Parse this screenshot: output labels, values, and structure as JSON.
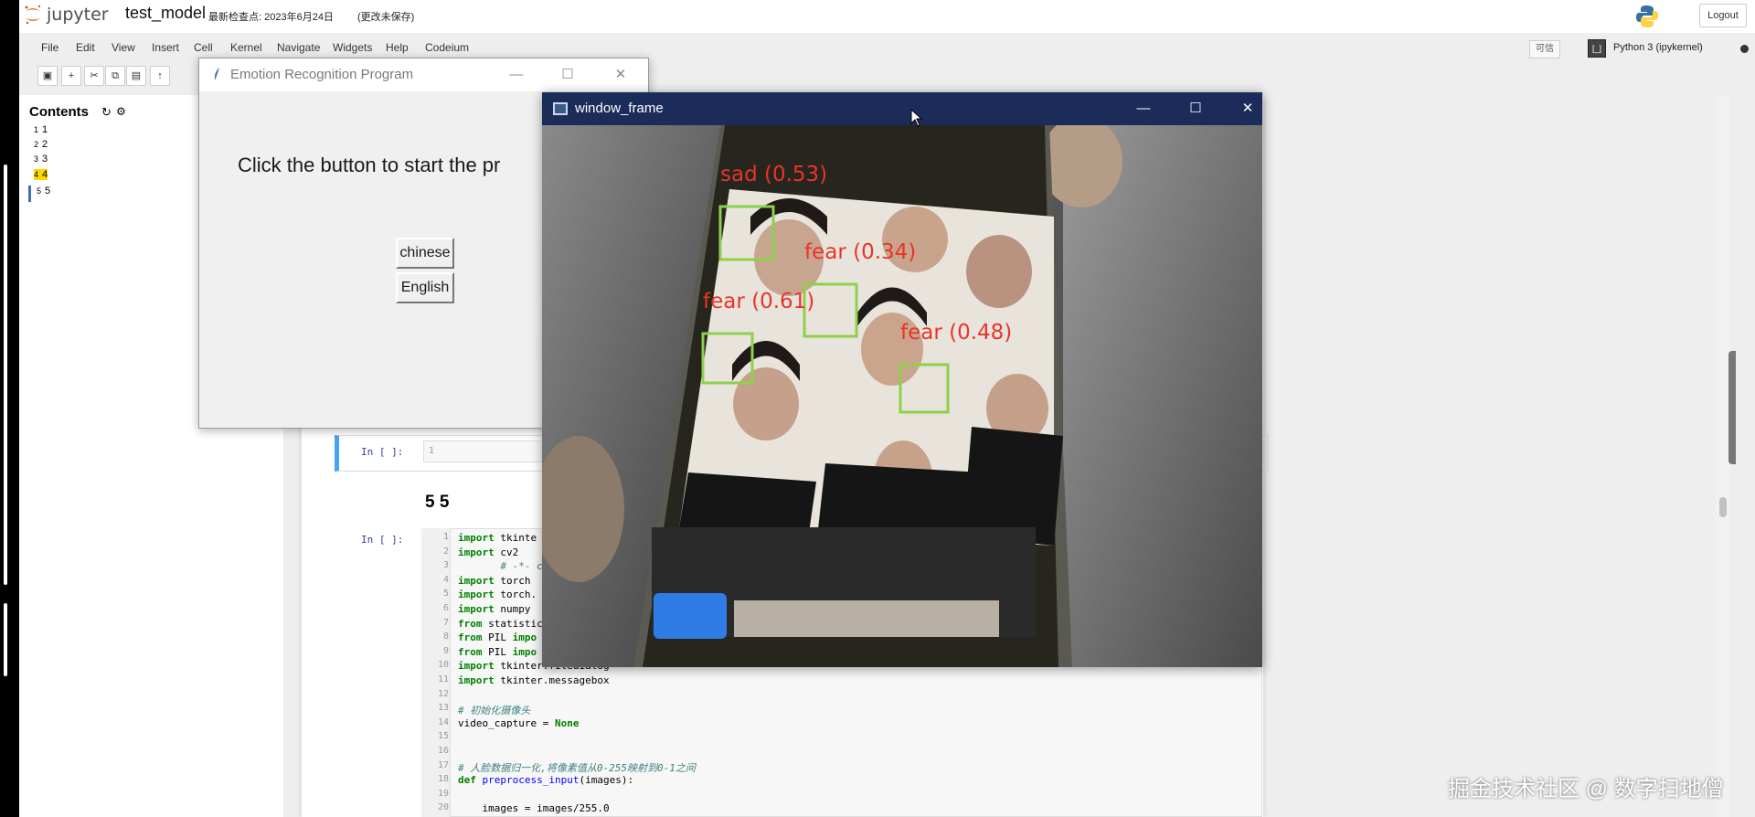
{
  "jupyter": {
    "wordmark": "jupyter",
    "notebook_name": "test_model",
    "checkpoint": "最新检查点: 2023年6月24日",
    "unsaved": "(更改未保存)",
    "logout": "Logout",
    "trusted": "可信",
    "kernel_name": "Python 3 (ipykernel)"
  },
  "menu": [
    "File",
    "Edit",
    "View",
    "Insert",
    "Cell",
    "Kernel",
    "Navigate",
    "Widgets",
    "Help",
    "Codeium"
  ],
  "toc": {
    "title": "Contents",
    "items": [
      {
        "num": "1",
        "label": "1"
      },
      {
        "num": "2",
        "label": "2"
      },
      {
        "num": "3",
        "label": "3"
      },
      {
        "num": "4",
        "label": "4"
      },
      {
        "num": "5",
        "label": "5"
      }
    ]
  },
  "cells": {
    "prompt1": "In [ ]:",
    "line1": "1",
    "heading": "5  5",
    "prompt2": "In [ ]:",
    "code": [
      {
        "n": "1",
        "parts": [
          [
            "kw",
            "import"
          ],
          [
            "",
            " tkinte"
          ]
        ]
      },
      {
        "n": "2",
        "parts": [
          [
            "kw",
            "import"
          ],
          [
            "",
            " cv2"
          ]
        ]
      },
      {
        "n": "3",
        "parts": [
          [
            "",
            "       "
          ],
          [
            "cm",
            "# -*- c"
          ]
        ]
      },
      {
        "n": "4",
        "parts": [
          [
            "kw",
            "import"
          ],
          [
            "",
            " torch"
          ]
        ]
      },
      {
        "n": "5",
        "parts": [
          [
            "kw",
            "import"
          ],
          [
            "",
            " torch."
          ]
        ]
      },
      {
        "n": "6",
        "parts": [
          [
            "kw",
            "import"
          ],
          [
            "",
            " numpy"
          ]
        ]
      },
      {
        "n": "7",
        "parts": [
          [
            "kw",
            "from"
          ],
          [
            "",
            " statistic"
          ]
        ]
      },
      {
        "n": "8",
        "parts": [
          [
            "kw",
            "from"
          ],
          [
            "",
            " PIL "
          ],
          [
            "kw",
            "impo"
          ]
        ]
      },
      {
        "n": "9",
        "parts": [
          [
            "kw",
            "from"
          ],
          [
            "",
            " PIL "
          ],
          [
            "kw",
            "impo"
          ]
        ]
      },
      {
        "n": "10",
        "parts": [
          [
            "kw",
            "import"
          ],
          [
            "",
            " tkinter.filedialog"
          ]
        ]
      },
      {
        "n": "11",
        "parts": [
          [
            "kw",
            "import"
          ],
          [
            "",
            " tkinter.messagebox"
          ]
        ]
      },
      {
        "n": "12",
        "parts": [
          [
            "",
            ""
          ]
        ]
      },
      {
        "n": "13",
        "parts": [
          [
            "cm",
            "# 初始化摄像头"
          ]
        ]
      },
      {
        "n": "14",
        "parts": [
          [
            "",
            "video_capture = "
          ],
          [
            "kw",
            "None"
          ]
        ]
      },
      {
        "n": "15",
        "parts": [
          [
            "",
            ""
          ]
        ]
      },
      {
        "n": "16",
        "parts": [
          [
            "",
            ""
          ]
        ]
      },
      {
        "n": "17",
        "parts": [
          [
            "cm",
            "# 人脸数据归一化,将像素值从0-255映射到0-1之间"
          ]
        ]
      },
      {
        "n": "18",
        "parts": [
          [
            "kw",
            "def"
          ],
          [
            "",
            " "
          ],
          [
            "fn",
            "preprocess_input"
          ],
          [
            "",
            "(images):"
          ]
        ]
      },
      {
        "n": "19",
        "parts": [
          [
            "",
            ""
          ]
        ]
      },
      {
        "n": "20",
        "parts": [
          [
            "",
            "    images = images/255.0"
          ]
        ]
      }
    ]
  },
  "emotion_window": {
    "title": "Emotion Recognition Program",
    "prompt": "Click the button to start the pr",
    "btn_chinese": "chinese",
    "btn_english": "English",
    "ctrl_min": "—",
    "ctrl_max": "☐",
    "ctrl_close": "✕"
  },
  "frame_window": {
    "title": "window_frame",
    "ctrl_min": "—",
    "ctrl_max": "☐",
    "ctrl_close": "✕",
    "detections": [
      {
        "label": "sad (0.53)"
      },
      {
        "label": "fear (0.34)"
      },
      {
        "label": "fear (0.61)"
      },
      {
        "label": "fear (0.48)"
      }
    ],
    "box_color": "#8ed04a",
    "label_color": "#e8342a"
  },
  "watermark": "掘金技术社区 @ 数字扫地僧"
}
